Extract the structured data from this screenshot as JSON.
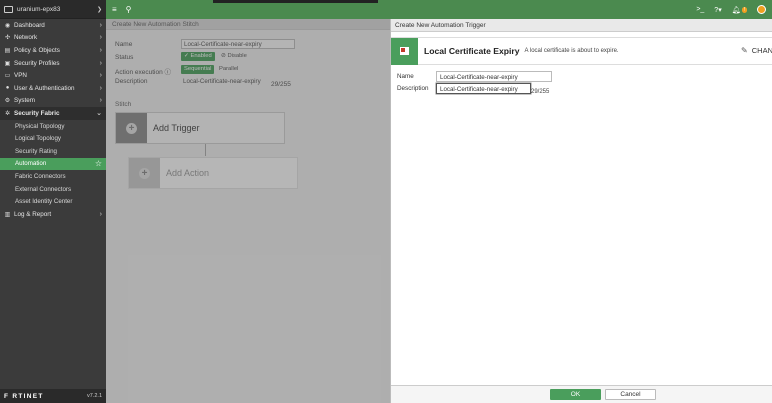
{
  "sidebar": {
    "device_name": "uranium-epx83",
    "items": [
      {
        "label": "Dashboard",
        "icon": "dashboard-icon"
      },
      {
        "label": "Network",
        "icon": "network-icon"
      },
      {
        "label": "Policy & Objects",
        "icon": "policy-icon"
      },
      {
        "label": "Security Profiles",
        "icon": "lock-icon"
      },
      {
        "label": "VPN",
        "icon": "monitor-icon"
      },
      {
        "label": "User & Authentication",
        "icon": "user-icon"
      },
      {
        "label": "System",
        "icon": "gear-icon"
      },
      {
        "label": "Security Fabric",
        "icon": "fabric-icon"
      }
    ],
    "sub_items": [
      {
        "label": "Physical Topology"
      },
      {
        "label": "Logical Topology"
      },
      {
        "label": "Security Rating"
      },
      {
        "label": "Automation"
      },
      {
        "label": "Fabric Connectors"
      },
      {
        "label": "External Connectors"
      },
      {
        "label": "Asset Identity Center"
      }
    ],
    "log_report": {
      "label": "Log & Report",
      "icon": "chart-icon"
    },
    "brand": "F RTINET",
    "version": "v7.2.1"
  },
  "editor": {
    "title": "Create New Automation Stitch",
    "name_label": "Name",
    "name_value": "Local-Certificate-near-expiry",
    "status_label": "Status",
    "status_enabled": "Enabled",
    "status_disabled": "Disable",
    "action_exec_label": "Action execution",
    "exec_sequential": "Sequential",
    "exec_parallel": "Parallel",
    "description_label": "Description",
    "description_value": "Local-Certificate-near-expiry",
    "description_counter": "29/255",
    "stitch_label": "Stitch",
    "add_trigger": "Add Trigger",
    "add_action": "Add Action"
  },
  "panel": {
    "title": "Create New Automation Trigger",
    "trigger_name": "Local Certificate Expiry",
    "trigger_desc": "A local certificate is about to expire.",
    "change_label": "CHAN",
    "name_label": "Name",
    "name_value": "Local-Certificate-near-expiry",
    "description_label": "Description",
    "description_value": "Local-Certificate-near-expiry",
    "description_counter": "29/255",
    "ok_label": "OK",
    "cancel_label": "Cancel"
  },
  "colors": {
    "accent_green": "#4a9e5c",
    "topbar_green": "#4b8a4f",
    "sidebar_bg": "#3b3b3b"
  }
}
